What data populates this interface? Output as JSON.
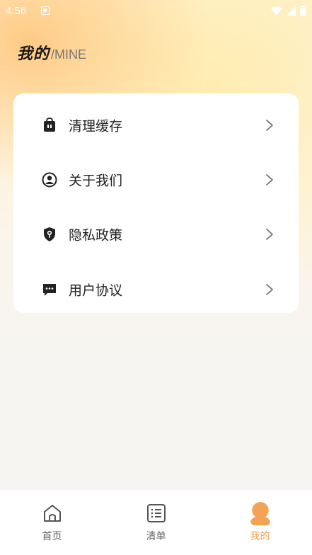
{
  "status_bar": {
    "time": "4:56"
  },
  "header": {
    "title_cn": "我的",
    "title_en": "/MINE"
  },
  "menu": {
    "items": [
      {
        "label": "清理缓存",
        "icon": "trash-bag-icon"
      },
      {
        "label": "关于我们",
        "icon": "user-circle-icon"
      },
      {
        "label": "隐私政策",
        "icon": "shield-key-icon"
      },
      {
        "label": "用户协议",
        "icon": "chat-bubble-icon"
      }
    ]
  },
  "tabbar": {
    "tabs": [
      {
        "label": "首页",
        "icon": "home-icon"
      },
      {
        "label": "清单",
        "icon": "list-icon"
      },
      {
        "label": "我的",
        "icon": "person-icon",
        "active": true
      }
    ]
  },
  "colors": {
    "accent": "#f4a354",
    "text": "#222222",
    "tab_inactive": "#666666"
  }
}
